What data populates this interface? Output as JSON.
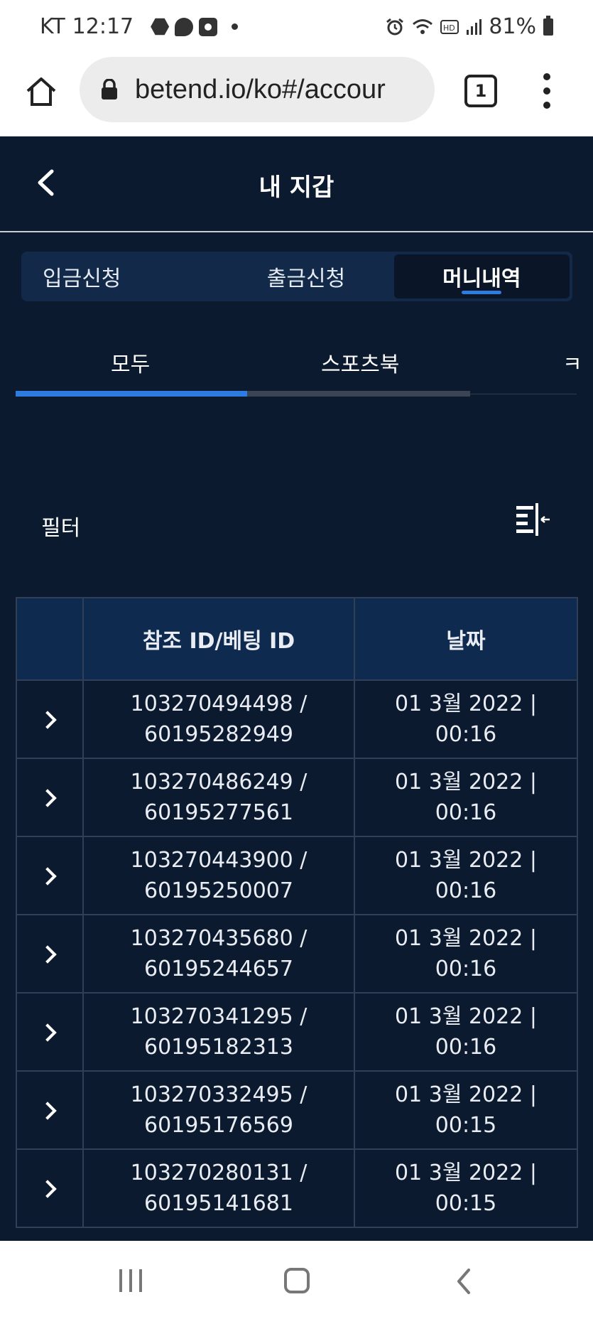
{
  "status_bar": {
    "carrier": "KT",
    "time": "12:17",
    "battery": "81%"
  },
  "browser": {
    "url": "betend.io/ko#/accour",
    "tab_count": "1"
  },
  "header": {
    "title": "내 지갑"
  },
  "segment_tabs": [
    {
      "label": "입금신청",
      "active": false
    },
    {
      "label": "출금신청",
      "active": false
    },
    {
      "label": "머니내역",
      "active": true
    }
  ],
  "sub_tabs": {
    "all": "모두",
    "sportsbook": "스포츠북",
    "partial": "ㅋ"
  },
  "filter": {
    "label": "필터"
  },
  "table": {
    "headers": [
      "",
      "참조 ID/베팅 ID",
      "날짜"
    ],
    "rows": [
      {
        "ref": "103270494498 /",
        "bet": "60195282949",
        "date": "01 3월 2022 |",
        "time": "00:16"
      },
      {
        "ref": "103270486249 /",
        "bet": "60195277561",
        "date": "01 3월 2022 |",
        "time": "00:16"
      },
      {
        "ref": "103270443900 /",
        "bet": "60195250007",
        "date": "01 3월 2022 |",
        "time": "00:16"
      },
      {
        "ref": "103270435680 /",
        "bet": "60195244657",
        "date": "01 3월 2022 |",
        "time": "00:16"
      },
      {
        "ref": "103270341295 /",
        "bet": "60195182313",
        "date": "01 3월 2022 |",
        "time": "00:16"
      },
      {
        "ref": "103270332495 /",
        "bet": "60195176569",
        "date": "01 3월 2022 |",
        "time": "00:15"
      },
      {
        "ref": "103270280131 /",
        "bet": "60195141681",
        "date": "01 3월 2022 |",
        "time": "00:15"
      }
    ]
  },
  "colors": {
    "app_background": "#0b1a2e",
    "accent": "#2f7ce0",
    "table_header": "#0e2a4e"
  }
}
